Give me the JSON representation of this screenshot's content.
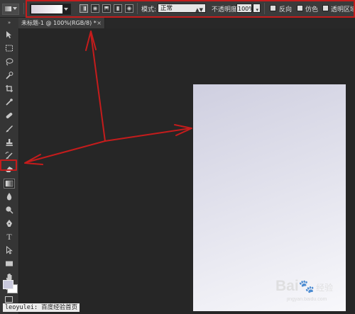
{
  "options_bar": {
    "mode_label": "模式:",
    "mode_value": "正常",
    "opacity_label": "不透明度:",
    "opacity_value": "100%",
    "reverse_label": "反向",
    "dither_label": "仿色",
    "transparency_label": "透明区域",
    "gradient_colors": [
      "#d9d0dc",
      "#ffffff"
    ]
  },
  "document_tab": {
    "title": "未标题-1 @ 100%(RGB/8) *",
    "close_glyph": "×"
  },
  "toolbox": {
    "tools": [
      "move-icon",
      "marquee-icon",
      "lasso-icon",
      "quick-select-icon",
      "crop-icon",
      "eyedropper-icon",
      "healing-brush-icon",
      "brush-icon",
      "clone-stamp-icon",
      "history-brush-icon",
      "eraser-icon",
      "gradient-icon",
      "blur-icon",
      "dodge-icon",
      "pen-icon",
      "type-icon",
      "path-select-icon",
      "rectangle-icon",
      "hand-icon",
      "zoom-icon"
    ],
    "selected_tool": "gradient-icon",
    "foreground_color": "#c9c9dc",
    "background_color": "#ffffff"
  },
  "canvas": {
    "background": "#262626",
    "document_gradient": [
      "#cfcfe0",
      "#f8f8fb"
    ]
  },
  "annotation": {
    "color": "#c51c1c"
  },
  "watermarks": {
    "user": "leoyulei: 百度经验首页",
    "baidu_text": "Bai",
    "baidu_paw": "🐾",
    "baidu_suffix": "经验",
    "baidu_url": "jingyan.baidu.com"
  }
}
